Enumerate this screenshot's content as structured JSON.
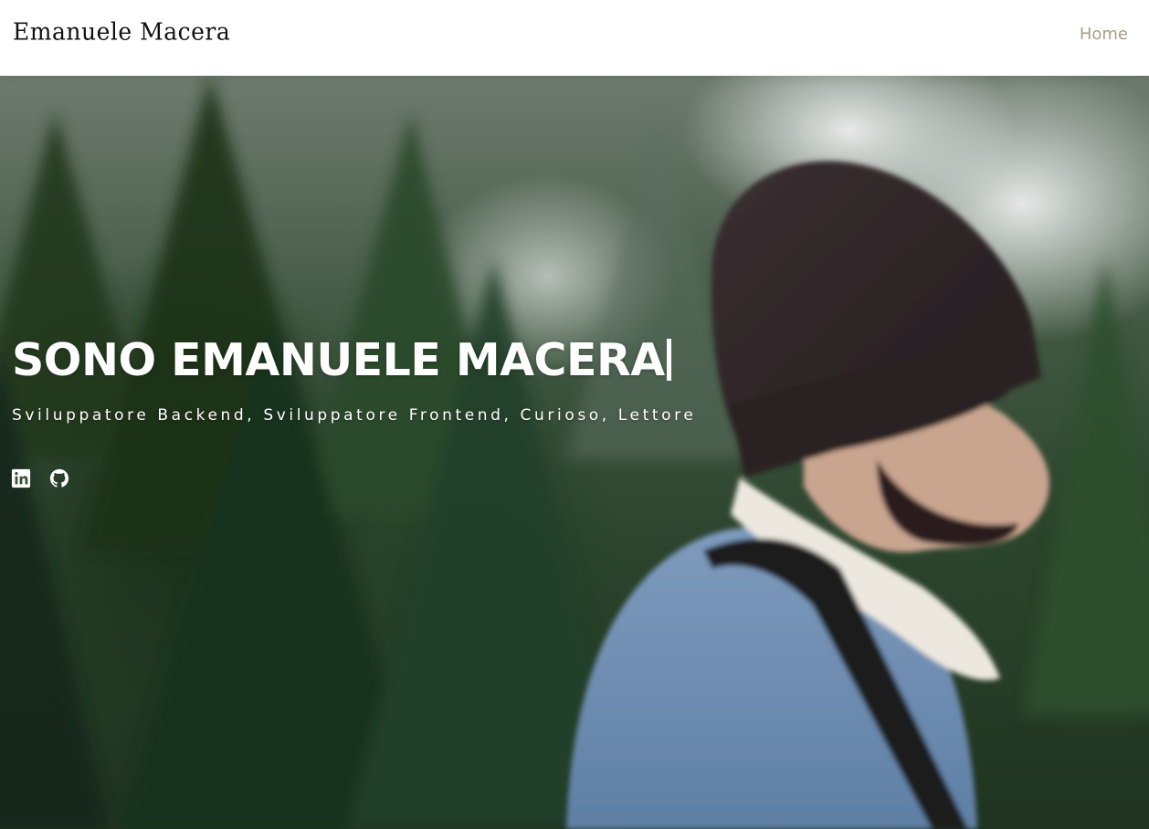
{
  "header": {
    "brand": "Emanuele Macera",
    "nav": [
      {
        "label": "Home"
      }
    ]
  },
  "hero": {
    "title": "SONO EMANUELE MACERA",
    "subtitle": "Sviluppatore Backend, Sviluppatore Frontend, Curioso, Lettore",
    "social_links": [
      {
        "icon": "linkedin-icon"
      },
      {
        "icon": "github-icon"
      }
    ]
  },
  "colors": {
    "nav_link": "#a79f84",
    "hero_text": "#ffffff",
    "header_bg": "#ffffff"
  }
}
